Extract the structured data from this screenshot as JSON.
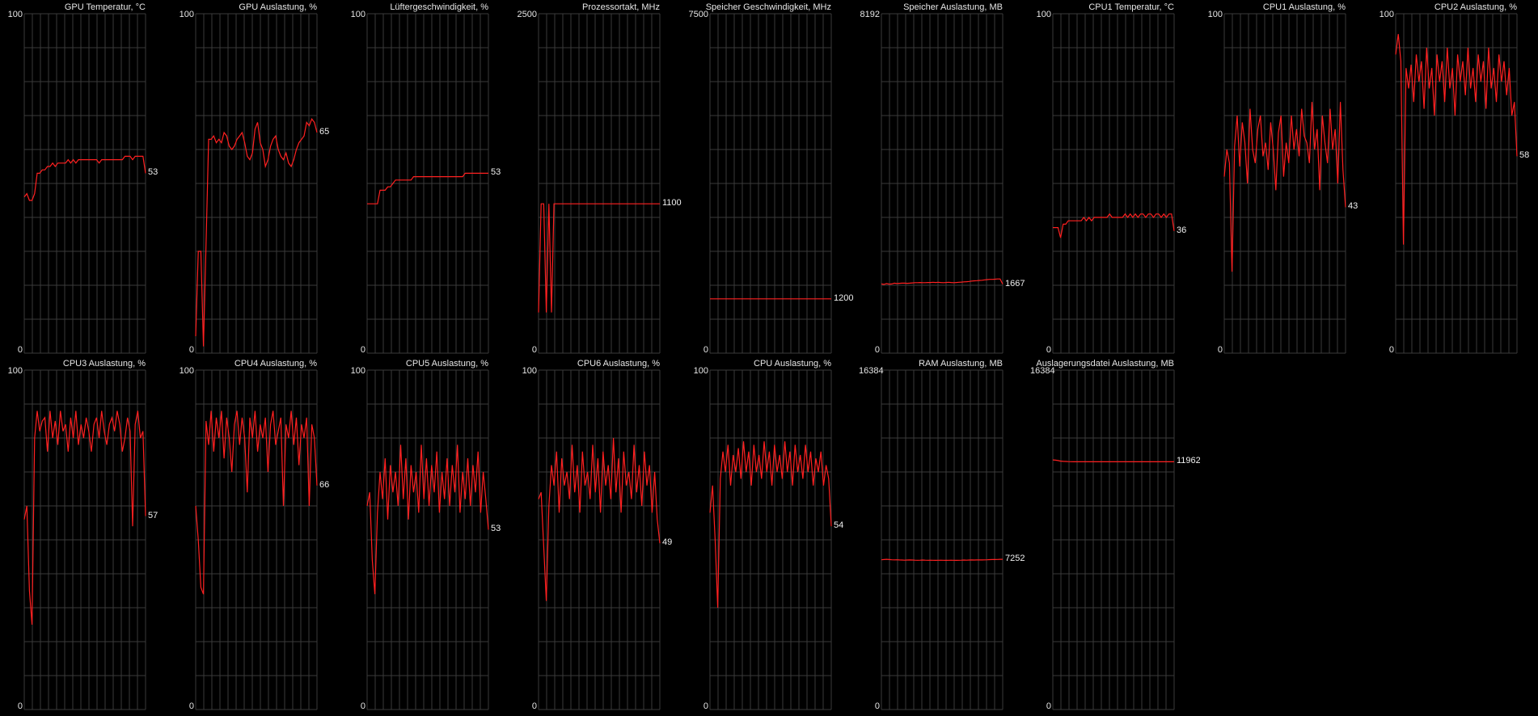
{
  "window": {
    "background": "#000000",
    "grid_color": "#3a3a3a",
    "line_color": "#ff2020",
    "text_color": "#e6e6e6"
  },
  "graphs": [
    {
      "title": "GPU Temperatur, °C",
      "min": 0,
      "max": 100,
      "current": 53,
      "samples": [
        46,
        47,
        45,
        45,
        47,
        53,
        53,
        54,
        54,
        55,
        55,
        56,
        55,
        56,
        56,
        56,
        56,
        57,
        56,
        57,
        56,
        57,
        57,
        57,
        57,
        57,
        57,
        57,
        57,
        56,
        57,
        57,
        57,
        57,
        57,
        57,
        57,
        57,
        57,
        58,
        58,
        58,
        57,
        58,
        58,
        58,
        58,
        53
      ]
    },
    {
      "title": "GPU Auslastung, %",
      "min": 0,
      "max": 100,
      "current": 65,
      "samples": [
        5,
        30,
        30,
        2,
        32,
        63,
        63,
        64,
        62,
        63,
        62,
        65,
        64,
        61,
        60,
        61,
        63,
        64,
        65,
        62,
        58,
        57,
        59,
        66,
        68,
        62,
        60,
        55,
        57,
        61,
        63,
        64,
        60,
        58,
        57,
        59,
        56,
        55,
        57,
        60,
        62,
        63,
        64,
        68,
        67,
        69,
        68,
        65
      ]
    },
    {
      "title": "Lüftergeschwindigkeit, %",
      "min": 0,
      "max": 100,
      "current": 53,
      "samples": [
        44,
        44,
        44,
        44,
        44,
        48,
        48,
        48,
        49,
        49,
        50,
        51,
        51,
        51,
        51,
        51,
        51,
        51,
        52,
        52,
        52,
        52,
        52,
        52,
        52,
        52,
        52,
        52,
        52,
        52,
        52,
        52,
        52,
        52,
        52,
        52,
        52,
        52,
        53,
        53,
        53,
        53,
        53,
        53,
        53,
        53,
        53,
        53
      ]
    },
    {
      "title": "Prozessortakt, MHz",
      "min": 0,
      "max": 2500,
      "current": 1100,
      "samples": [
        300,
        1100,
        1100,
        300,
        1100,
        300,
        1100,
        1100,
        1100,
        1100,
        1100,
        1100,
        1100,
        1100,
        1100,
        1100,
        1100,
        1100,
        1100,
        1100,
        1100,
        1100,
        1100,
        1100,
        1100,
        1100,
        1100,
        1100,
        1100,
        1100,
        1100,
        1100,
        1100,
        1100,
        1100,
        1100,
        1100,
        1100,
        1100,
        1100,
        1100,
        1100,
        1100,
        1100,
        1100,
        1100,
        1100,
        1100
      ]
    },
    {
      "title": "Speicher Geschwindigkeit, MHz",
      "min": 0,
      "max": 7500,
      "current": 1200,
      "samples": [
        1200,
        1200,
        1200,
        1200,
        1200,
        1200,
        1200,
        1200,
        1200,
        1200,
        1200,
        1200,
        1200,
        1200,
        1200,
        1200,
        1200,
        1200,
        1200,
        1200,
        1200,
        1200,
        1200,
        1200,
        1200,
        1200,
        1200,
        1200,
        1200,
        1200,
        1200,
        1200,
        1200,
        1200,
        1200,
        1200,
        1200,
        1200,
        1200,
        1200,
        1200,
        1200,
        1200,
        1200,
        1200,
        1200,
        1200,
        1200
      ]
    },
    {
      "title": "Speicher Auslastung, MB",
      "min": 0,
      "max": 8192,
      "current": 1667,
      "samples": [
        1670,
        1660,
        1680,
        1665,
        1670,
        1690,
        1680,
        1685,
        1690,
        1690,
        1685,
        1690,
        1695,
        1700,
        1700,
        1705,
        1700,
        1700,
        1705,
        1705,
        1710,
        1705,
        1710,
        1705,
        1700,
        1705,
        1710,
        1705,
        1700,
        1705,
        1710,
        1715,
        1720,
        1725,
        1730,
        1740,
        1745,
        1750,
        1755,
        1760,
        1770,
        1775,
        1780,
        1780,
        1785,
        1790,
        1790,
        1667
      ]
    },
    {
      "title": "CPU1 Temperatur, °C",
      "min": 0,
      "max": 100,
      "current": 36,
      "samples": [
        37,
        37,
        37,
        34,
        38,
        38,
        39,
        39,
        39,
        39,
        39,
        39,
        40,
        39,
        40,
        39,
        40,
        40,
        40,
        40,
        40,
        40,
        41,
        40,
        40,
        40,
        40,
        40,
        41,
        40,
        41,
        40,
        41,
        40,
        41,
        41,
        40,
        41,
        41,
        40,
        41,
        41,
        40,
        41,
        40,
        41,
        41,
        36
      ]
    },
    {
      "title": "CPU1 Auslastung, %",
      "min": 0,
      "max": 100,
      "current": 43,
      "samples": [
        52,
        60,
        56,
        24,
        61,
        70,
        55,
        68,
        62,
        50,
        72,
        60,
        56,
        66,
        70,
        58,
        62,
        54,
        68,
        60,
        48,
        65,
        70,
        52,
        62,
        56,
        70,
        60,
        66,
        58,
        72,
        64,
        62,
        56,
        74,
        60,
        66,
        48,
        70,
        62,
        56,
        72,
        60,
        66,
        50,
        74,
        54,
        43
      ]
    },
    {
      "title": "CPU2 Auslastung, %",
      "min": 0,
      "max": 100,
      "current": 58,
      "samples": [
        88,
        94,
        86,
        32,
        84,
        78,
        85,
        74,
        88,
        80,
        86,
        72,
        90,
        78,
        84,
        70,
        88,
        80,
        86,
        74,
        90,
        78,
        84,
        70,
        88,
        80,
        86,
        76,
        90,
        78,
        84,
        74,
        88,
        80,
        86,
        72,
        90,
        78,
        84,
        74,
        88,
        80,
        86,
        76,
        84,
        70,
        74,
        58
      ]
    },
    {
      "title": "CPU3 Auslastung, %",
      "min": 0,
      "max": 100,
      "current": 57,
      "samples": [
        56,
        60,
        35,
        25,
        80,
        88,
        82,
        85,
        86,
        76,
        88,
        80,
        85,
        78,
        88,
        82,
        84,
        76,
        86,
        80,
        88,
        78,
        84,
        80,
        86,
        82,
        76,
        84,
        86,
        80,
        88,
        82,
        78,
        84,
        86,
        82,
        88,
        84,
        76,
        80,
        86,
        82,
        54,
        84,
        88,
        80,
        82,
        57
      ]
    },
    {
      "title": "CPU4 Auslastung, %",
      "min": 0,
      "max": 100,
      "current": 66,
      "samples": [
        60,
        50,
        36,
        34,
        85,
        78,
        88,
        76,
        86,
        80,
        88,
        74,
        86,
        80,
        70,
        84,
        88,
        78,
        86,
        80,
        64,
        86,
        80,
        88,
        76,
        84,
        80,
        86,
        70,
        84,
        88,
        78,
        82,
        86,
        60,
        84,
        80,
        88,
        78,
        86,
        72,
        84,
        80,
        86,
        60,
        84,
        80,
        66
      ]
    },
    {
      "title": "CPU5 Auslastung, %",
      "min": 0,
      "max": 100,
      "current": 53,
      "samples": [
        60,
        64,
        44,
        34,
        58,
        70,
        62,
        74,
        56,
        72,
        64,
        70,
        60,
        78,
        62,
        74,
        56,
        72,
        64,
        70,
        58,
        78,
        62,
        74,
        60,
        72,
        64,
        76,
        58,
        70,
        62,
        74,
        60,
        72,
        64,
        78,
        58,
        70,
        62,
        74,
        60,
        72,
        64,
        76,
        58,
        70,
        62,
        53
      ]
    },
    {
      "title": "CPU6 Auslastung, %",
      "min": 0,
      "max": 100,
      "current": 49,
      "samples": [
        62,
        64,
        48,
        32,
        60,
        72,
        66,
        76,
        58,
        74,
        66,
        70,
        62,
        78,
        64,
        72,
        58,
        76,
        66,
        70,
        62,
        78,
        64,
        74,
        58,
        76,
        66,
        72,
        62,
        80,
        64,
        74,
        58,
        76,
        66,
        70,
        62,
        78,
        64,
        72,
        60,
        76,
        66,
        72,
        58,
        70,
        56,
        49
      ]
    },
    {
      "title": "CPU Auslastung, %",
      "min": 0,
      "max": 100,
      "current": 54,
      "samples": [
        58,
        66,
        50,
        30,
        68,
        76,
        70,
        78,
        66,
        75,
        70,
        77,
        68,
        79,
        70,
        76,
        66,
        78,
        70,
        75,
        68,
        79,
        70,
        76,
        66,
        78,
        70,
        75,
        68,
        79,
        70,
        76,
        66,
        78,
        70,
        75,
        68,
        78,
        70,
        76,
        66,
        74,
        70,
        76,
        66,
        72,
        68,
        54
      ]
    },
    {
      "title": "RAM Auslastung, MB",
      "min": 0,
      "max": 16384,
      "current": 7252,
      "samples": [
        7230,
        7240,
        7250,
        7240,
        7230,
        7225,
        7230,
        7220,
        7215,
        7210,
        7215,
        7220,
        7215,
        7210,
        7205,
        7210,
        7215,
        7210,
        7205,
        7210,
        7205,
        7200,
        7205,
        7210,
        7205,
        7200,
        7205,
        7210,
        7205,
        7200,
        7205,
        7210,
        7215,
        7210,
        7215,
        7220,
        7215,
        7220,
        7225,
        7220,
        7225,
        7230,
        7235,
        7240,
        7240,
        7245,
        7250,
        7252
      ]
    },
    {
      "title": "Auslagerungsdatei Auslastung, MB",
      "min": 0,
      "max": 16384,
      "current": 11962,
      "samples": [
        12050,
        12040,
        12020,
        11990,
        11980,
        11975,
        11970,
        11965,
        11960,
        11962,
        11965,
        11960,
        11962,
        11965,
        11962,
        11960,
        11962,
        11965,
        11962,
        11960,
        11962,
        11965,
        11962,
        11960,
        11962,
        11965,
        11962,
        11960,
        11962,
        11965,
        11962,
        11960,
        11962,
        11965,
        11962,
        11960,
        11962,
        11965,
        11962,
        11960,
        11962,
        11965,
        11962,
        11960,
        11962,
        11965,
        11962,
        11962
      ]
    }
  ]
}
